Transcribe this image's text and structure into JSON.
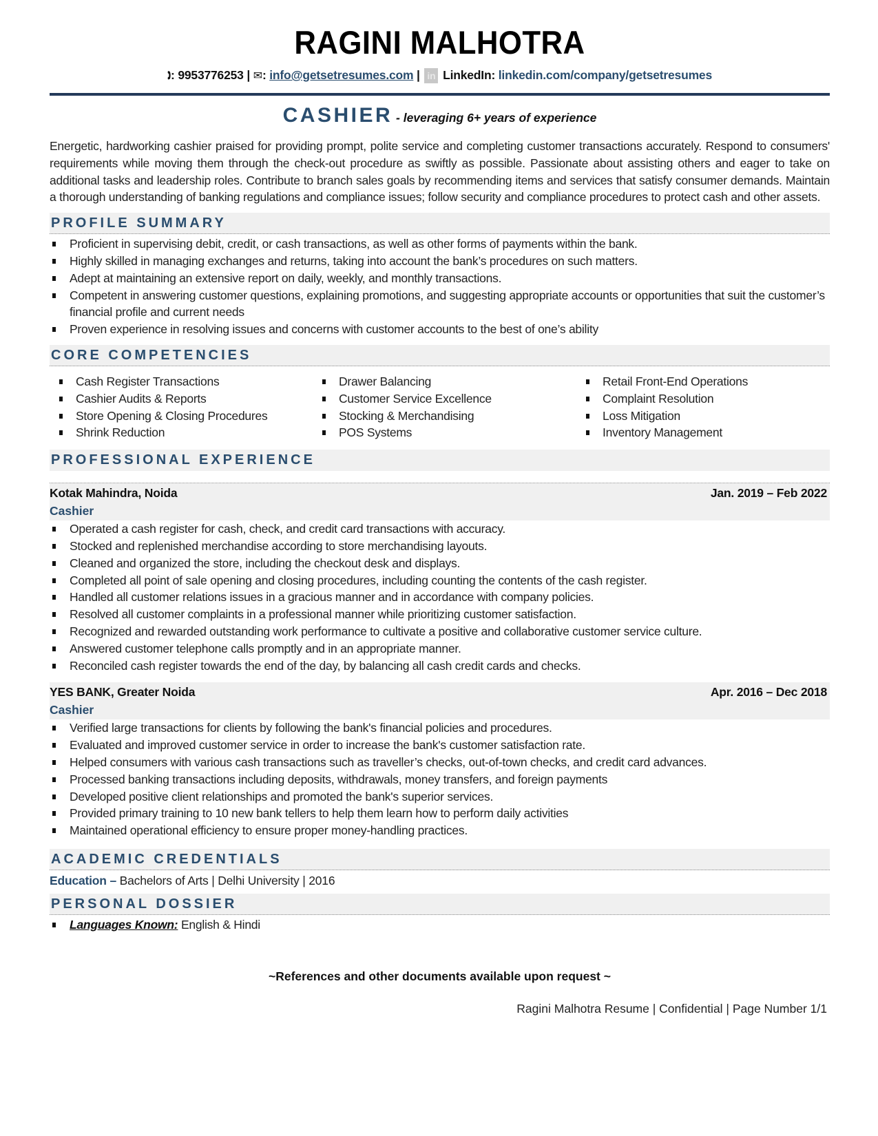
{
  "header": {
    "name": "RAGINI MALHOTRA",
    "phone_icon": "phone-icon",
    "phone": "9953776253",
    "email_icon": "envelope-icon",
    "email": "info@getsetresumes.com",
    "linkedin_icon": "linkedin-icon",
    "linkedin_label": "LinkedIn:",
    "linkedin_url": "linkedin.com/company/getsetresumes",
    "separator": "|",
    "colon": ":"
  },
  "title": {
    "role": "CASHIER",
    "tagline": " - leveraging 6+ years of experience"
  },
  "summary": "Energetic, hardworking cashier praised for providing prompt, polite service and completing customer transactions accurately. Respond to consumers' requirements while moving them through the check-out procedure as swiftly as possible. Passionate about assisting others and eager to take on additional tasks and leadership roles. Contribute to branch sales goals by recommending items and services that satisfy consumer demands. Maintain a thorough understanding of banking regulations and compliance issues; follow security and compliance procedures to protect cash and other assets.",
  "profile_summary": {
    "heading": "PROFILE SUMMARY",
    "items": [
      "Proficient in supervising debit, credit, or cash transactions, as well as other forms of payments within the bank.",
      "Highly skilled in managing exchanges and returns, taking into account the bank’s procedures on such matters.",
      "Adept at maintaining an extensive report on daily, weekly, and monthly transactions.",
      "Competent in answering customer questions, explaining promotions, and suggesting appropriate accounts or opportunities that suit the customer’s financial profile and current needs",
      "Proven experience in resolving issues and concerns with customer accounts to the best of one’s ability"
    ]
  },
  "core_competencies": {
    "heading": "CORE COMPETENCIES",
    "columns": [
      [
        "Cash Register Transactions",
        "Cashier Audits & Reports",
        "Store Opening & Closing Procedures",
        "Shrink Reduction"
      ],
      [
        "Drawer Balancing",
        "Customer Service Excellence",
        "Stocking & Merchandising",
        "POS Systems"
      ],
      [
        "Retail Front-End Operations",
        "Complaint Resolution",
        "Loss Mitigation",
        "Inventory Management"
      ]
    ]
  },
  "experience": {
    "heading": "PROFESSIONAL EXPERIENCE",
    "jobs": [
      {
        "company": "Kotak Mahindra, Noida",
        "dates": "Jan. 2019 – Feb 2022",
        "title": "Cashier",
        "bullets": [
          "Operated a cash register for cash, check, and credit card transactions with accuracy.",
          "Stocked and replenished merchandise according to store merchandising layouts.",
          "Cleaned and organized the store, including the checkout desk and displays.",
          "Completed all point of sale opening and closing procedures, including counting the contents of the cash register.",
          "Handled all customer relations issues in a gracious manner and in accordance with company policies.",
          "Resolved all customer complaints in a professional manner while prioritizing customer satisfaction.",
          "Recognized and rewarded outstanding work performance to cultivate a positive and collaborative customer service culture.",
          "Answered customer telephone calls promptly and in an appropriate manner.",
          "Reconciled cash register towards the end of the day, by balancing all cash credit cards and checks."
        ]
      },
      {
        "company": "YES BANK, Greater Noida",
        "dates": "Apr. 2016 – Dec 2018",
        "title": "Cashier",
        "bullets": [
          "Verified large transactions for clients by following the bank's financial policies and procedures.",
          "Evaluated and improved customer service in order to increase the bank's customer satisfaction rate.",
          "Helped consumers with various cash transactions such as traveller’s checks, out-of-town checks, and credit card advances.",
          "Processed banking transactions including deposits, withdrawals, money transfers, and foreign payments",
          "Developed positive client relationships and promoted the bank's superior services.",
          "Provided primary training to 10 new bank tellers to help them learn how to perform daily activities",
          "Maintained operational efficiency to ensure proper money-handling practices."
        ]
      }
    ]
  },
  "academic": {
    "heading": "ACADEMIC CREDENTIALS",
    "label": "Education –",
    "value": " Bachelors of Arts | Delhi University | 2016"
  },
  "personal": {
    "heading": "PERSONAL DOSSIER",
    "languages_label": "Languages Known:",
    "languages_value": " English & Hindi"
  },
  "closing": {
    "references": "~References and other documents available upon request ~",
    "footer": "Ragini Malhotra Resume | Confidential | Page Number 1/1"
  },
  "colors": {
    "accent": "#2a4d6e",
    "rule": "#243a5a",
    "section_bg": "#f0f0f0"
  }
}
